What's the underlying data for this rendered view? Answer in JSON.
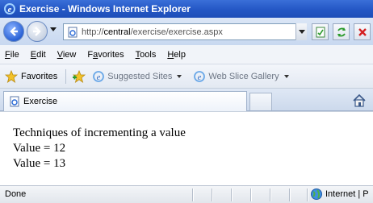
{
  "window": {
    "title": "Exercise - Windows Internet Explorer"
  },
  "address": {
    "url_prefix": "http://",
    "url_host": "central",
    "url_path": "/exercise/exercise.aspx"
  },
  "menu": {
    "items": [
      "File",
      "Edit",
      "View",
      "Favorites",
      "Tools",
      "Help"
    ]
  },
  "favorites_bar": {
    "favorites_label": "Favorites",
    "suggested_sites": "Suggested Sites",
    "web_slice_gallery": "Web Slice Gallery"
  },
  "tab": {
    "label": "Exercise"
  },
  "content": {
    "lines": [
      "Techniques of incrementing a value",
      "Value = 12",
      "Value = 13"
    ]
  },
  "status": {
    "text": "Done",
    "zone": "Internet | P"
  },
  "icons": {
    "back": "back-arrow-icon",
    "forward": "forward-arrow-icon",
    "compatibility": "compatibility-view-icon",
    "refresh": "refresh-icon",
    "stop": "stop-icon",
    "favorites": "star-icon",
    "add_favorites": "add-to-favorites-icon",
    "suggested": "ie-logo-icon",
    "home": "home-icon",
    "zone": "globe-icon"
  }
}
